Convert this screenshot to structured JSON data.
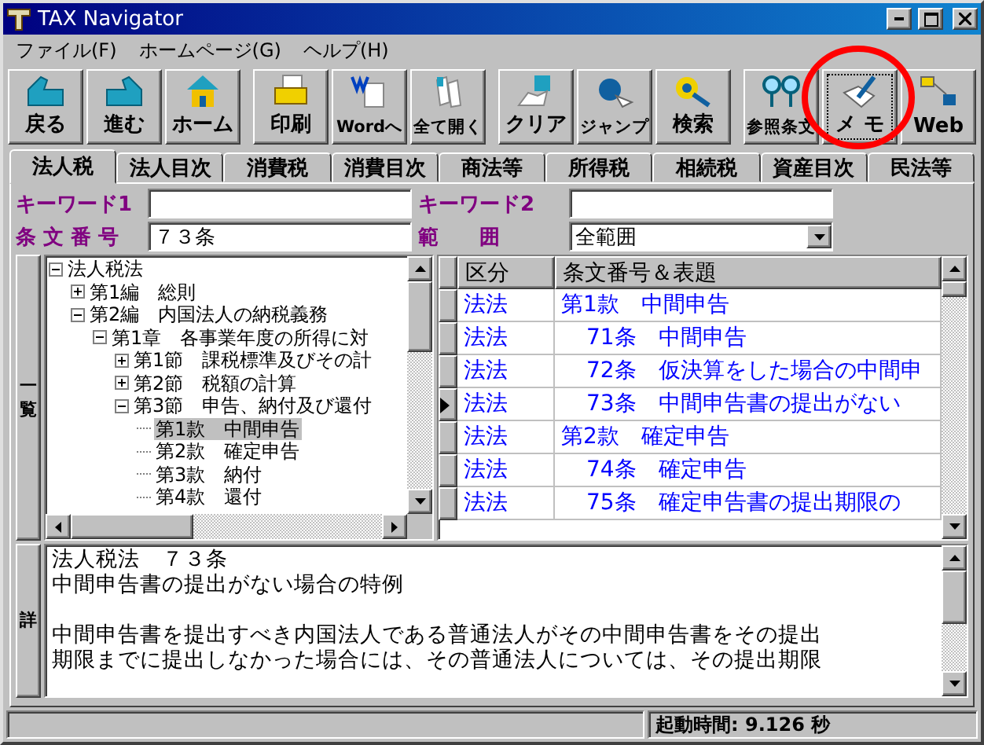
{
  "window": {
    "title": "TAX Navigator"
  },
  "menu": [
    "ファイル(F)",
    "ホームページ(G)",
    "ヘルプ(H)"
  ],
  "toolbar": [
    [
      {
        "label": "戻る",
        "selected": false
      },
      {
        "label": "進む",
        "selected": false
      },
      {
        "label": "ホーム",
        "selected": false
      }
    ],
    [
      {
        "label": "印刷",
        "selected": false
      },
      {
        "label": "Wordへ",
        "selected": false
      },
      {
        "label": "全て開く",
        "selected": false
      }
    ],
    [
      {
        "label": "クリア",
        "selected": false
      },
      {
        "label": "ジャンプ",
        "selected": false
      },
      {
        "label": "検索",
        "selected": false
      }
    ],
    [
      {
        "label": "参照条文",
        "selected": false
      },
      {
        "label": "メ モ",
        "selected": true
      },
      {
        "label": "Web",
        "selected": false
      }
    ]
  ],
  "tabs": [
    {
      "label": "法人税",
      "selected": true
    },
    {
      "label": "法人目次",
      "selected": false
    },
    {
      "label": "消費税",
      "selected": false
    },
    {
      "label": "消費目次",
      "selected": false
    },
    {
      "label": "商法等",
      "selected": false
    },
    {
      "label": "所得税",
      "selected": false
    },
    {
      "label": "相続税",
      "selected": false
    },
    {
      "label": "資産目次",
      "selected": false
    },
    {
      "label": "民法等",
      "selected": false
    }
  ],
  "search": {
    "keyword1_label": "キーワード1",
    "keyword2_label": "キーワード2",
    "article_label": "条 文 番 号",
    "article": "７３条",
    "range_label": "範　　囲",
    "range": "全範囲"
  },
  "list_label": "一覧",
  "tree": [
    {
      "label": "法人税法",
      "expanded": true,
      "selected": false,
      "children": [
        {
          "label": "第1編　総則",
          "expanded": false,
          "selected": false
        },
        {
          "label": "第2編　内国法人の納税義務",
          "expanded": true,
          "selected": false,
          "children": [
            {
              "label": "第1章　各事業年度の所得に対",
              "expanded": true,
              "selected": false,
              "children": [
                {
                  "label": "第1節　課税標準及びその計",
                  "expanded": false,
                  "selected": false
                },
                {
                  "label": "第2節　税額の計算",
                  "expanded": false,
                  "selected": false
                },
                {
                  "label": "第3節　申告、納付及び還付",
                  "expanded": true,
                  "selected": false,
                  "children": [
                    {
                      "label": "第1款　中間申告",
                      "selected": true
                    },
                    {
                      "label": "第2款　確定申告",
                      "selected": false
                    },
                    {
                      "label": "第3款　納付",
                      "selected": false
                    },
                    {
                      "label": "第4款　還付",
                      "selected": false
                    }
                  ]
                }
              ]
            }
          ]
        }
      ]
    }
  ],
  "table": {
    "columns": [
      "区分",
      "条文番号＆表題"
    ],
    "rows": [
      {
        "kind": "section",
        "category": "法法",
        "title": "第1款　中間申告",
        "selected": false
      },
      {
        "kind": "article",
        "category": "法法",
        "title": "71条　中間申告",
        "selected": false
      },
      {
        "kind": "article",
        "category": "法法",
        "title": "72条　仮決算をした場合の中間申",
        "selected": false
      },
      {
        "kind": "article",
        "category": "法法",
        "title": "73条　中間申告書の提出がない",
        "selected": true
      },
      {
        "kind": "section",
        "category": "法法",
        "title": "第2款　確定申告",
        "selected": false
      },
      {
        "kind": "article",
        "category": "法法",
        "title": "74条　確定申告",
        "selected": false
      },
      {
        "kind": "article",
        "category": "法法",
        "title": "75条　確定申告書の提出期限の",
        "selected": false
      }
    ]
  },
  "detail_label": "詳",
  "detail": {
    "heading": "法人税法　７３条",
    "title": "中間申告書の提出がない場合の特例",
    "body": [
      "中間申告書を提出すべき内国法人である普通法人がその中間申告書をその提出",
      "期限までに提出しなかった場合には、その普通法人については、その提出期限"
    ]
  },
  "status_bar": {
    "startup": "起動時間:  9.126 秒"
  }
}
